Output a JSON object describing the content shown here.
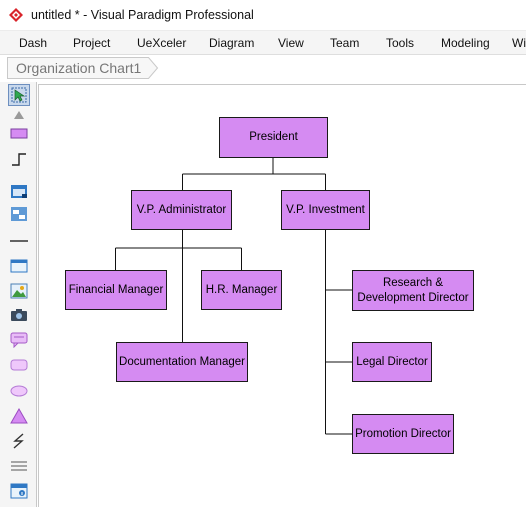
{
  "window": {
    "title": "untitled * - Visual Paradigm Professional"
  },
  "menu": {
    "items": [
      "Dash",
      "Project",
      "UeXceler",
      "Diagram",
      "View",
      "Team",
      "Tools",
      "Modeling",
      "Wi"
    ]
  },
  "breadcrumb": {
    "label": "Organization Chart1"
  },
  "toolbox": {
    "tools": [
      "selector-tool",
      "scroll-up-tool",
      "rectangle-tool",
      "connector-tool",
      "folder-tool",
      "group-tool",
      "line-tool",
      "window-tool",
      "image-tool",
      "camera-tool",
      "callout-tool",
      "rounded-rectangle-tool",
      "ellipse-tool",
      "triangle-tool",
      "lightning-tool",
      "text-lines-tool",
      "info-panel-tool"
    ]
  },
  "diagram": {
    "shape_fill": "#d58bf2",
    "shape_border": "#1a1a1a",
    "nodes": {
      "president": "President",
      "vp_admin": "V.P. Administrator",
      "vp_invest": "V.P. Investment",
      "financial_manager": "Financial Manager",
      "hr_manager": "H.R. Manager",
      "documentation_manager": "Documentation Manager",
      "rd_director": "Research &\nDevelopment Director",
      "legal_director": "Legal Director",
      "promotion_director": "Promotion Director"
    }
  }
}
